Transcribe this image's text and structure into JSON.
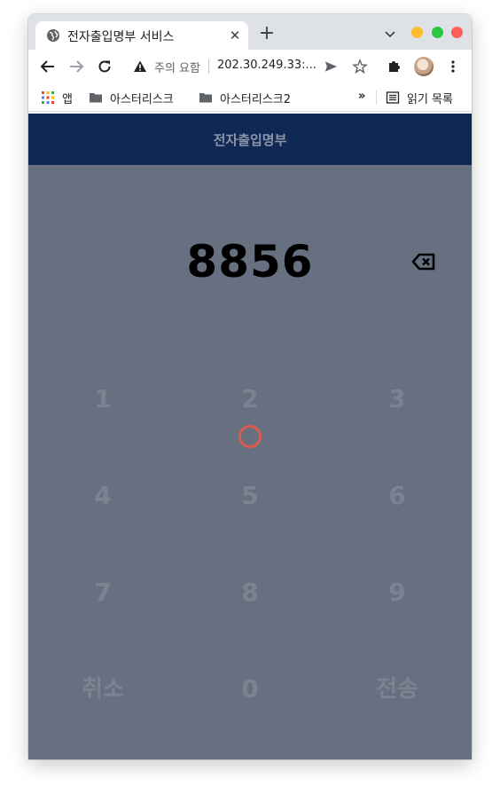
{
  "browser": {
    "tab": {
      "title": "전자출입명부 서비스",
      "close_glyph": "✕",
      "favicon": "globe-icon"
    },
    "new_tab_glyph": "+",
    "address_bar": {
      "security_status": "주의 요함",
      "url": "202.30.249.33:..."
    },
    "bookmarks": [
      {
        "label": "앱",
        "icon": "apps-grid-icon"
      },
      {
        "label": "아스터리스크",
        "icon": "folder-icon"
      },
      {
        "label": "아스터리스크2",
        "icon": "folder-icon"
      }
    ],
    "bookmarks_overflow": "»",
    "reading_list": "읽기 목록"
  },
  "app": {
    "title": "전자출입명부",
    "pin": "8856",
    "keypad": {
      "rows": [
        [
          "1",
          "2",
          "3"
        ],
        [
          "4",
          "5",
          "6"
        ],
        [
          "7",
          "8",
          "9"
        ],
        [
          "취소",
          "0",
          "전송"
        ]
      ]
    }
  },
  "colors": {
    "header_bg": "#0f2954",
    "page_bg": "#667080",
    "key_text": "#7b8391",
    "touch_indicator": "#e0594f"
  }
}
